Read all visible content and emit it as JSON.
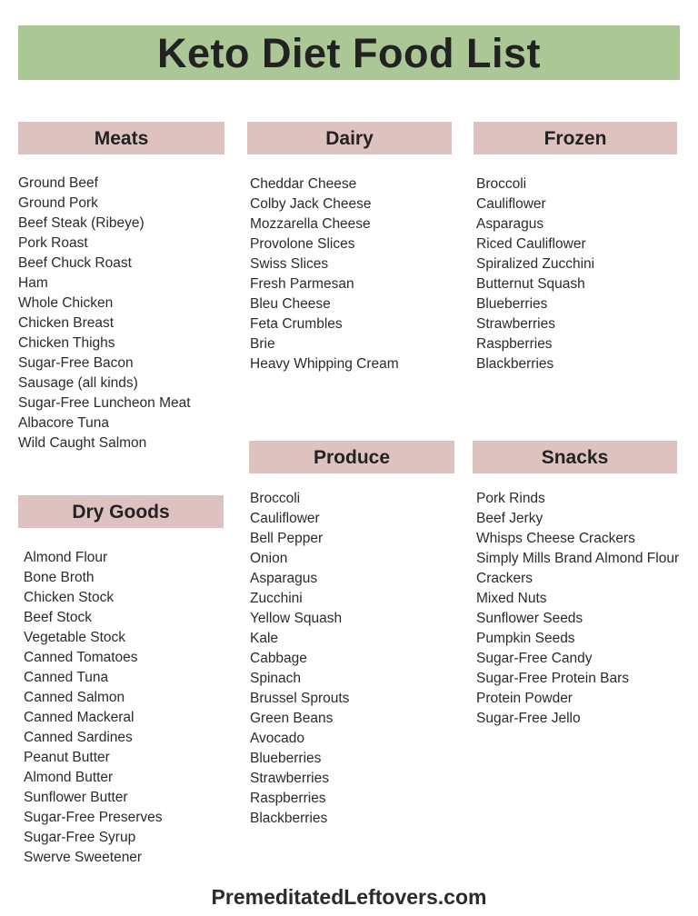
{
  "page": {
    "title": "Keto Diet Food List",
    "background_color": "#ffffff",
    "banner_color": "#aac795",
    "header_color": "#dec2c0",
    "text_color": "#2b2b2b"
  },
  "footer": {
    "site": "PremeditatedLeftovers.com"
  },
  "sections": {
    "meats": {
      "heading": "Meats",
      "items": [
        "Ground Beef",
        "Ground Pork",
        "Beef Steak (Ribeye)",
        "Pork Roast",
        "Beef Chuck Roast",
        "Ham",
        "Whole Chicken",
        "Chicken Breast",
        "Chicken Thighs",
        "Sugar-Free Bacon",
        "Sausage (all kinds)",
        "Sugar-Free Luncheon Meat",
        "Albacore Tuna",
        "Wild Caught Salmon"
      ]
    },
    "dairy": {
      "heading": "Dairy",
      "items": [
        "Cheddar Cheese",
        "Colby Jack Cheese",
        "Mozzarella Cheese",
        "Provolone Slices",
        "Swiss Slices",
        "Fresh Parmesan",
        "Bleu Cheese",
        "Feta Crumbles",
        "Brie",
        "Heavy Whipping Cream"
      ]
    },
    "frozen": {
      "heading": "Frozen",
      "items": [
        "Broccoli",
        "Cauliflower",
        "Asparagus",
        "Riced Cauliflower",
        "Spiralized Zucchini",
        "Butternut Squash",
        "Blueberries",
        "Strawberries",
        "Raspberries",
        "Blackberries"
      ]
    },
    "dry_goods": {
      "heading": "Dry Goods",
      "items": [
        "Almond Flour",
        "Bone Broth",
        "Chicken Stock",
        "Beef Stock",
        "Vegetable Stock",
        "Canned Tomatoes",
        "Canned Tuna",
        "Canned Salmon",
        "Canned Mackeral",
        "Canned Sardines",
        "Peanut Butter",
        "Almond Butter",
        "Sunflower Butter",
        "Sugar-Free Preserves",
        "Sugar-Free Syrup",
        "Swerve Sweetener"
      ]
    },
    "produce": {
      "heading": "Produce",
      "items": [
        "Broccoli",
        "Cauliflower",
        "Bell Pepper",
        "Onion",
        "Asparagus",
        "Zucchini",
        "Yellow Squash",
        "Kale",
        "Cabbage",
        "Spinach",
        "Brussel Sprouts",
        "Green Beans",
        "Avocado",
        "Blueberries",
        "Strawberries",
        "Raspberries",
        "Blackberries"
      ]
    },
    "snacks": {
      "heading": "Snacks",
      "items": [
        "Pork Rinds",
        "Beef Jerky",
        "Whisps Cheese Crackers",
        "Simply Mills Brand Almond Flour Crackers",
        "Mixed Nuts",
        "Sunflower Seeds",
        "Pumpkin Seeds",
        "Sugar-Free Candy",
        "Sugar-Free Protein Bars",
        "Protein Powder",
        "Sugar-Free Jello"
      ]
    }
  }
}
